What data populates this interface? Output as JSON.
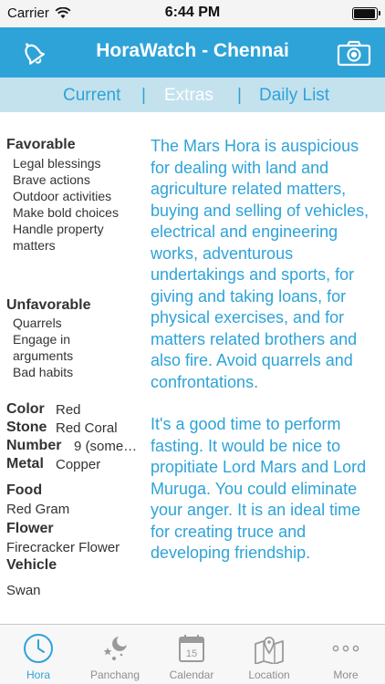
{
  "status_bar": {
    "carrier": "Carrier",
    "time": "6:44 PM",
    "battery_level": 1.0
  },
  "nav": {
    "title": "HoraWatch - Chennai",
    "left_icon": "bell-icon",
    "right_icon": "camera-icon"
  },
  "segments": {
    "current": "Current",
    "divider": "|",
    "extras": "Extras",
    "daily": "Daily List",
    "selected": "Extras"
  },
  "favorable": {
    "heading": "Favorable",
    "items": [
      "Legal blessings",
      "Brave actions",
      "Outdoor activities",
      "Make bold choices",
      "Handle property",
      "matters"
    ]
  },
  "unfavorable": {
    "heading": "Unfavorable",
    "items": [
      "Quarrels",
      "Engage in",
      "arguments",
      "Bad habits"
    ]
  },
  "attributes": {
    "color_label": "Color",
    "color_value": "Red",
    "stone_label": "Stone",
    "stone_value": "Red Coral",
    "number_label": "Number",
    "number_value": "9 (some…",
    "metal_label": "Metal",
    "metal_value": "Copper",
    "food_label": "Food",
    "food_value": "Red Gram",
    "flower_label": "Flower",
    "flower_value": "Firecracker Flower",
    "vehicle_label": "Vehicle",
    "vehicle_value": "Swan"
  },
  "description": {
    "paragraph1": "The Mars Hora is auspicious for dealing with land and agriculture related matters, buying and selling of vehicles, electrical and engineering works, adventurous undertakings and sports, for giving and taking loans, for physical exercises, and for matters related brothers and also fire. Avoid quarrels and confrontations.",
    "paragraph2": "It's a good time to perform fasting. It would be nice to propitiate Lord Mars and Lord Muruga. You could eliminate your anger. It is an ideal time for creating truce and developing friendship."
  },
  "tabs": [
    {
      "label": "Hora",
      "icon": "clock-icon",
      "active": true
    },
    {
      "label": "Panchang",
      "icon": "moon-stars-icon",
      "active": false
    },
    {
      "label": "Calendar",
      "icon": "calendar-icon",
      "calendar_day": "15",
      "active": false
    },
    {
      "label": "Location",
      "icon": "map-pin-icon",
      "active": false
    },
    {
      "label": "More",
      "icon": "more-dots-icon",
      "active": false
    }
  ],
  "colors": {
    "accent": "#2ea3d8",
    "segment_bg": "#c3e2ee",
    "text": "#333333"
  }
}
